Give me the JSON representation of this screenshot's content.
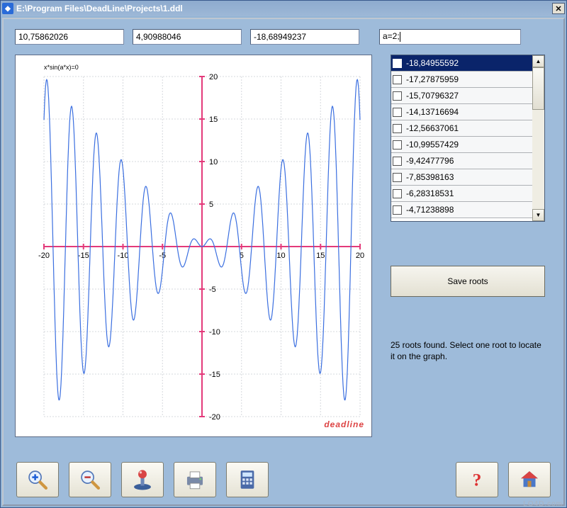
{
  "window": {
    "title": "E:\\Program Files\\DeadLine\\Projects\\1.ddl"
  },
  "inputs": {
    "val1": "10,75862026",
    "val2": "4,90988046",
    "val3": "-18,68949237",
    "param": "a=2;"
  },
  "chart_data": {
    "type": "line",
    "title": "x*sin(a*x)=0",
    "xlabel": "",
    "ylabel": "",
    "xlim": [
      -20,
      20
    ],
    "ylim": [
      -20,
      20
    ],
    "xticks": [
      -20,
      -15,
      -10,
      -5,
      0,
      5,
      10,
      15,
      20
    ],
    "yticks": [
      -20,
      -15,
      -10,
      -5,
      0,
      5,
      10,
      15,
      20
    ],
    "series": [
      {
        "name": "x*sin(2x)",
        "function": "x*sin(2*x)",
        "x_range": [
          -20,
          20
        ],
        "samples": 801
      }
    ],
    "roots_visible": [
      -18.84955592,
      -17.27875959,
      -15.70796327,
      -14.13716694,
      -12.56637061,
      -10.99557429,
      -9.42477796,
      -7.85398163,
      -6.28318531,
      -4.71238898
    ],
    "watermark": "deadline"
  },
  "roots_list": {
    "selected_index": 0,
    "items": [
      "-18,84955592",
      "-17,27875959",
      "-15,70796327",
      "-14,13716694",
      "-12,56637061",
      "-10,99557429",
      "-9,42477796",
      "-7,85398163",
      "-6,28318531",
      "-4,71238898"
    ]
  },
  "buttons": {
    "save_roots": "Save roots"
  },
  "status": "25 roots found. Select one root to locate it on the graph.",
  "toolbar": {
    "zoom_in": "zoom-in",
    "zoom_out": "zoom-out",
    "pan": "pan",
    "print": "print",
    "calc": "calculator",
    "help": "help",
    "home": "home"
  },
  "footer": "LO4D.com"
}
